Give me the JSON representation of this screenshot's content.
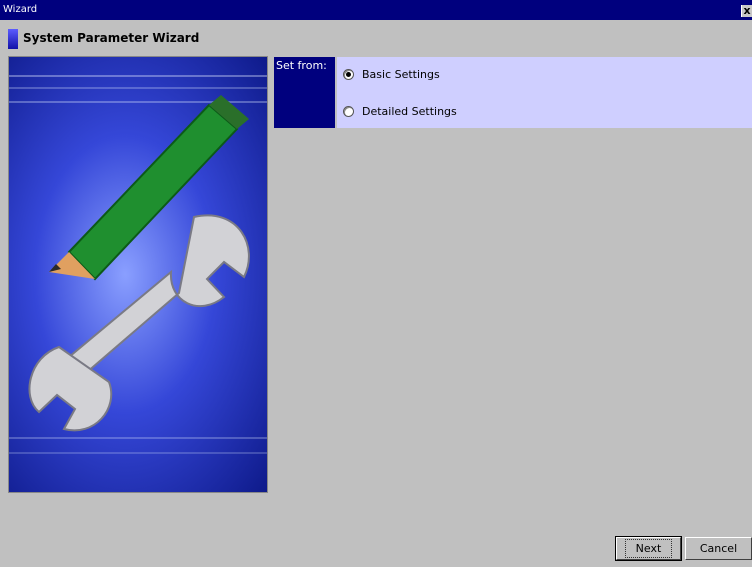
{
  "window": {
    "title": "Wizard",
    "close_label": "x"
  },
  "wizard": {
    "title": "System Parameter Wizard"
  },
  "settings": {
    "label": "Set from:",
    "options": [
      {
        "label": "Basic Settings",
        "selected": true
      },
      {
        "label": "Detailed Settings",
        "selected": false
      }
    ]
  },
  "buttons": {
    "next": "Next",
    "cancel": "Cancel"
  },
  "colors": {
    "titlebar": "#00007e",
    "panel": "#cfcfff",
    "background": "#c0c0c0"
  }
}
